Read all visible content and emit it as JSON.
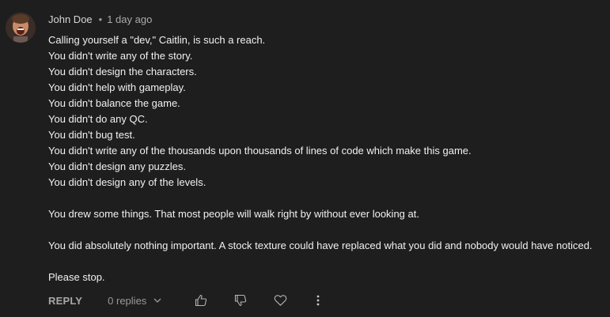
{
  "comment": {
    "author": "John Doe",
    "separator": "•",
    "timestamp": "1 day ago",
    "lines": [
      "Calling yourself a \"dev,\" Caitlin, is such a reach.",
      "You didn't write any of the story.",
      "You didn't design the characters.",
      "You didn't help with gameplay.",
      "You didn't balance the game.",
      "You didn't do any QC.",
      "You didn't bug test.",
      "You didn't write any of the thousands upon thousands of lines of code which make this game.",
      "You didn't design any puzzles.",
      "You didn't design any of the levels.",
      "",
      "You drew some things. That most people will walk right by without ever looking at.",
      "",
      "You did absolutely nothing important. A stock texture could have replaced what you did and nobody would have noticed.",
      "",
      "Please stop."
    ]
  },
  "actions": {
    "reply_label": "REPLY",
    "replies_label": "0 replies",
    "icons": [
      "thumbs-up-icon",
      "thumbs-down-icon",
      "heart-icon",
      "more-vertical-icon"
    ]
  }
}
